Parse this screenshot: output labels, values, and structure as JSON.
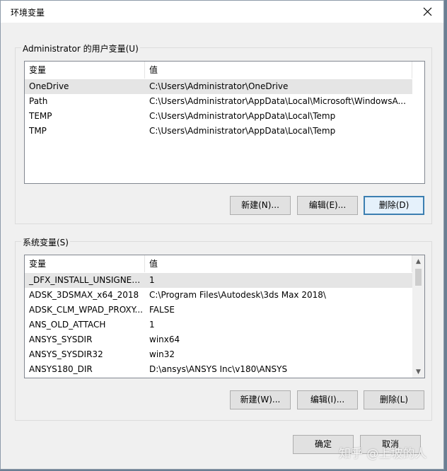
{
  "window": {
    "title": "环境变量"
  },
  "user_vars": {
    "group_label": "Administrator 的用户变量(U)",
    "columns": [
      "变量",
      "值"
    ],
    "rows": [
      {
        "name": "OneDrive",
        "value": "C:\\Users\\Administrator\\OneDrive"
      },
      {
        "name": "Path",
        "value": "C:\\Users\\Administrator\\AppData\\Local\\Microsoft\\WindowsA..."
      },
      {
        "name": "TEMP",
        "value": "C:\\Users\\Administrator\\AppData\\Local\\Temp"
      },
      {
        "name": "TMP",
        "value": "C:\\Users\\Administrator\\AppData\\Local\\Temp"
      }
    ],
    "buttons": {
      "new": "新建(N)...",
      "edit": "编辑(E)...",
      "delete": "删除(D)"
    }
  },
  "system_vars": {
    "group_label": "系统变量(S)",
    "columns": [
      "变量",
      "值"
    ],
    "rows": [
      {
        "name": "_DFX_INSTALL_UNSIGNED...",
        "value": "1"
      },
      {
        "name": "ADSK_3DSMAX_x64_2018",
        "value": "C:\\Program Files\\Autodesk\\3ds Max 2018\\"
      },
      {
        "name": "ADSK_CLM_WPAD_PROXY...",
        "value": "FALSE"
      },
      {
        "name": "ANS_OLD_ATTACH",
        "value": "1"
      },
      {
        "name": "ANSYS_SYSDIR",
        "value": "winx64"
      },
      {
        "name": "ANSYS_SYSDIR32",
        "value": "win32"
      },
      {
        "name": "ANSYS180_DIR",
        "value": "D:\\ansys\\ANSYS Inc\\v180\\ANSYS"
      }
    ],
    "buttons": {
      "new": "新建(W)...",
      "edit": "编辑(I)...",
      "delete": "删除(L)"
    }
  },
  "footer": {
    "ok": "确定",
    "cancel": "取消"
  },
  "watermark": "知乎 @上坡的人",
  "colors": {
    "focus_border": "#3c7fb1",
    "selected_row": "#e5e5e5",
    "dialog_bg": "#f0f0f0"
  }
}
